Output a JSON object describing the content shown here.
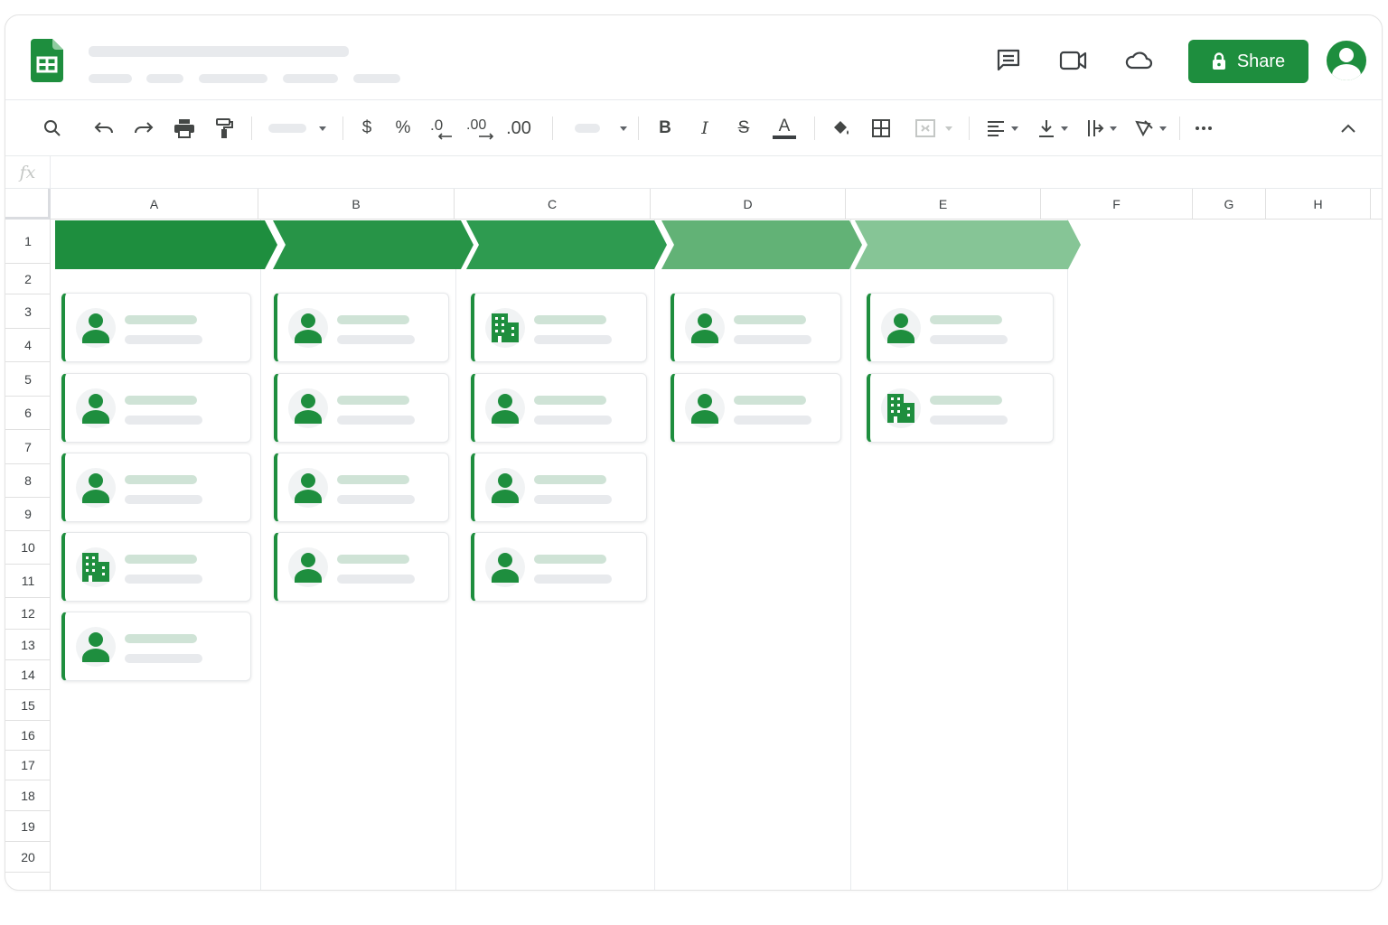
{
  "app": {
    "name": "Google Sheets",
    "accent_color": "#1e8e3e"
  },
  "header": {
    "icons": [
      "comment-icon",
      "video-call-icon",
      "cloud-icon"
    ],
    "share_label": "Share"
  },
  "toolbar": {
    "items": [
      "search-icon",
      "undo-icon",
      "redo-icon",
      "print-icon",
      "paint-format-icon",
      "zoom-select",
      "currency-icon",
      "percent-icon",
      "decrease-decimal-icon",
      "increase-decimal-icon",
      "format-icon",
      "font-select",
      "bold-icon",
      "italic-icon",
      "strikethrough-icon",
      "text-color-icon",
      "fill-color-icon",
      "borders-icon",
      "merge-cells-icon",
      "horizontal-align-icon",
      "vertical-align-icon",
      "text-wrap-icon",
      "text-rotation-icon",
      "more-icon",
      "collapse-icon"
    ],
    "currency_label": "$",
    "percent_label": "%",
    "decrease_decimal_label": ".0",
    "increase_decimal_label": ".00",
    "format_label": ".00",
    "bold_label": "B",
    "italic_label": "I",
    "strike_label": "S",
    "text_color_label": "A"
  },
  "formula_bar": {
    "fx_label": "fx",
    "value": ""
  },
  "columns": [
    "A",
    "B",
    "C",
    "D",
    "E",
    "F",
    "G",
    "H"
  ],
  "rows": [
    "1",
    "2",
    "3",
    "4",
    "5",
    "6",
    "7",
    "8",
    "9",
    "10",
    "11",
    "12",
    "13",
    "14",
    "15",
    "16",
    "17",
    "18",
    "19",
    "20"
  ],
  "stages": [
    {
      "color": "#1e8e3e"
    },
    {
      "color": "#279447"
    },
    {
      "color": "#2e9b50"
    },
    {
      "color": "#62b276"
    },
    {
      "color": "#86c596"
    }
  ],
  "board": [
    [
      "person",
      "person",
      "person",
      "building",
      "person"
    ],
    [
      "person",
      "person",
      "person",
      "person"
    ],
    [
      "building",
      "person",
      "person",
      "person"
    ],
    [
      "person",
      "person"
    ],
    [
      "person",
      "building"
    ]
  ]
}
